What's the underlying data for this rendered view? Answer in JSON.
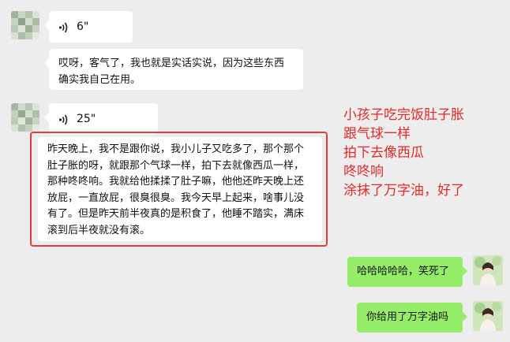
{
  "messages": {
    "voice1": {
      "duration": "6\""
    },
    "text1": {
      "text": "哎呀，客气了，我也就是实话实说，因为这些东西确实我自己在用。"
    },
    "voice2": {
      "duration": "25\""
    },
    "text2": {
      "text": "昨天晚上，我不是跟你说，我小儿子又吃多了，那个那个肚子胀的呀，就跟那个气球一样，拍下去就像西瓜一样，那种咚咚响。我就给他揉揉了肚子嘛，他他还昨天晚上还放屁，一直放屁，很臭很臭。我今天早上起来，啥事儿没有了。但是昨天前半夜真的是积食了，他睡不踏实，满床滚到后半夜就没有滚。"
    },
    "reply1": {
      "text": "哈哈哈哈哈，笑死了"
    },
    "reply2": {
      "text": "你给用了万字油吗"
    }
  },
  "annotation": {
    "lines": [
      "小孩子吃完饭肚子胀",
      "跟气球一样",
      "拍下去像西瓜",
      "咚咚响",
      "涂抹了万字油，好了"
    ],
    "color": "#e02a2a"
  },
  "colors": {
    "background": "#ededed",
    "bubble_white": "#ffffff",
    "bubble_green": "#95ec69",
    "highlight_frame": "#e23b3b"
  },
  "icons": [
    "voice-wave-icon",
    "blurred-avatar",
    "user-avatar"
  ]
}
